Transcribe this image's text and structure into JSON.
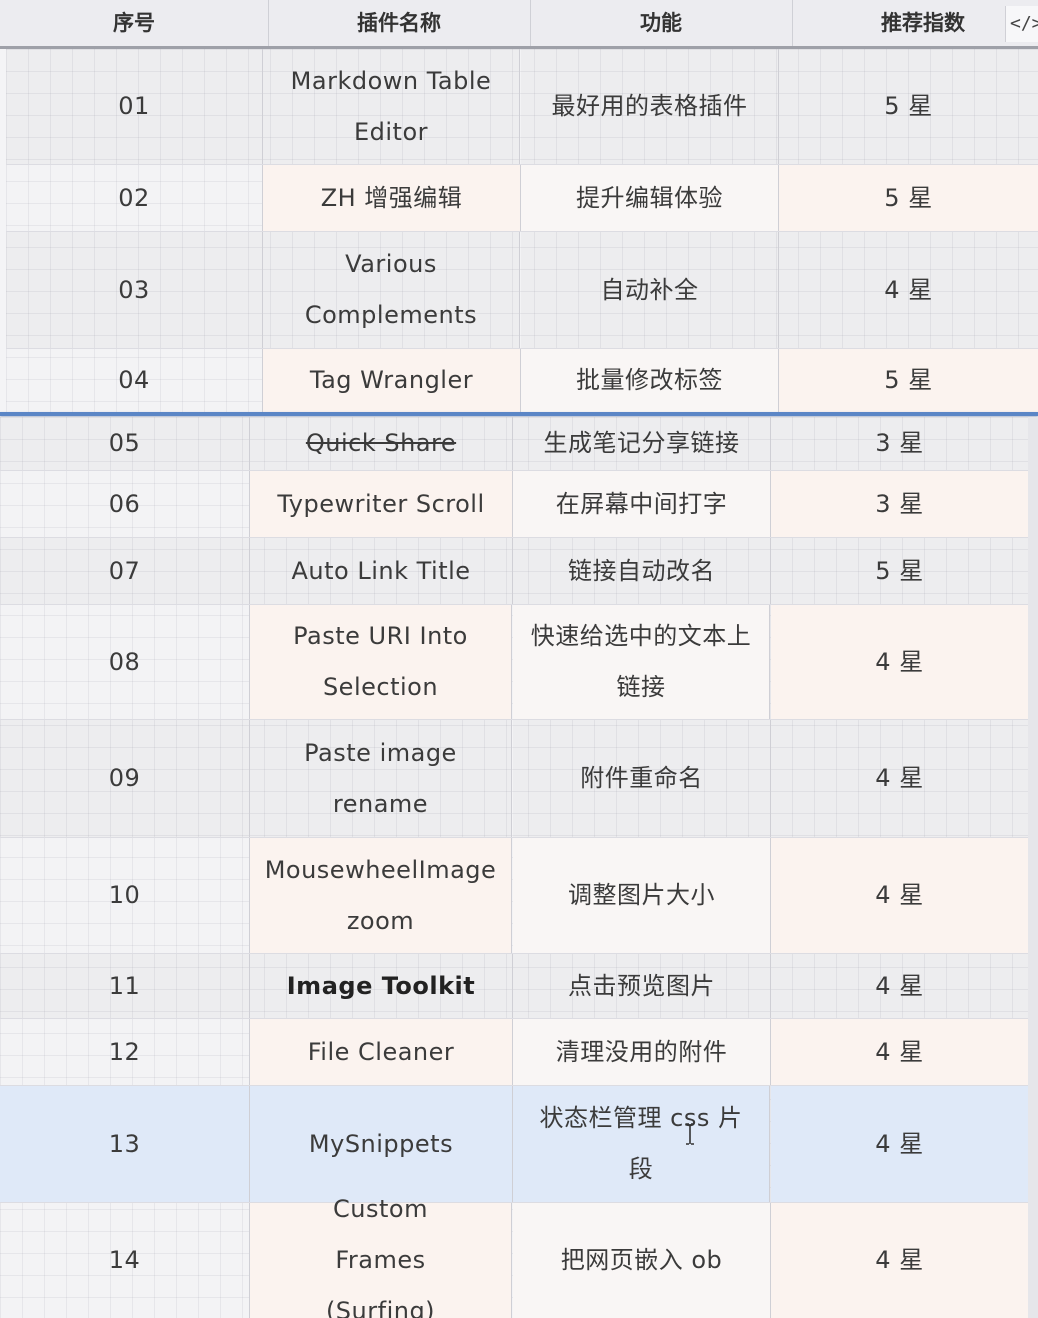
{
  "header": {
    "col_index": "序号",
    "col_name": "插件名称",
    "col_func": "功能",
    "col_rating": "推荐指数",
    "code_toggle": "</>"
  },
  "rows": [
    {
      "index": "01",
      "name": "Markdown Table Editor",
      "func": "最好用的表格插件",
      "rating": "5 星"
    },
    {
      "index": "02",
      "name": "ZH 增强编辑",
      "func": "提升编辑体验",
      "rating": "5 星"
    },
    {
      "index": "03",
      "name": "Various Complements",
      "func": "自动补全",
      "rating": "4 星"
    },
    {
      "index": "04",
      "name": "Tag Wrangler",
      "func": "批量修改标签",
      "rating": "5 星"
    },
    {
      "index": "05",
      "name": "Quick Share",
      "func": "生成笔记分享链接",
      "rating": "3 星"
    },
    {
      "index": "06",
      "name": "Typewriter Scroll",
      "func": "在屏幕中间打字",
      "rating": "3 星"
    },
    {
      "index": "07",
      "name": "Auto Link Title",
      "func": "链接自动改名",
      "rating": "5 星"
    },
    {
      "index": "08",
      "name": "Paste URI Into Selection",
      "func": "快速给选中的文本上链接",
      "rating": "4 星"
    },
    {
      "index": "09",
      "name": "Paste image rename",
      "func": "附件重命名",
      "rating": "4 星"
    },
    {
      "index": "10",
      "name": "MousewheelImage zoom",
      "func": "调整图片大小",
      "rating": "4 星"
    },
    {
      "index": "11",
      "name": "Image Toolkit",
      "func": "点击预览图片",
      "rating": "4 星"
    },
    {
      "index": "12",
      "name": "File Cleaner",
      "func": "清理没用的附件",
      "rating": "4 星"
    },
    {
      "index": "13",
      "name": "MySnippets",
      "func": "状态栏管理 css 片段",
      "rating": "4 星"
    },
    {
      "index": "14",
      "name": "Custom Frames (Surfing)",
      "func": "把网页嵌入 ob",
      "rating": "4 星"
    }
  ]
}
